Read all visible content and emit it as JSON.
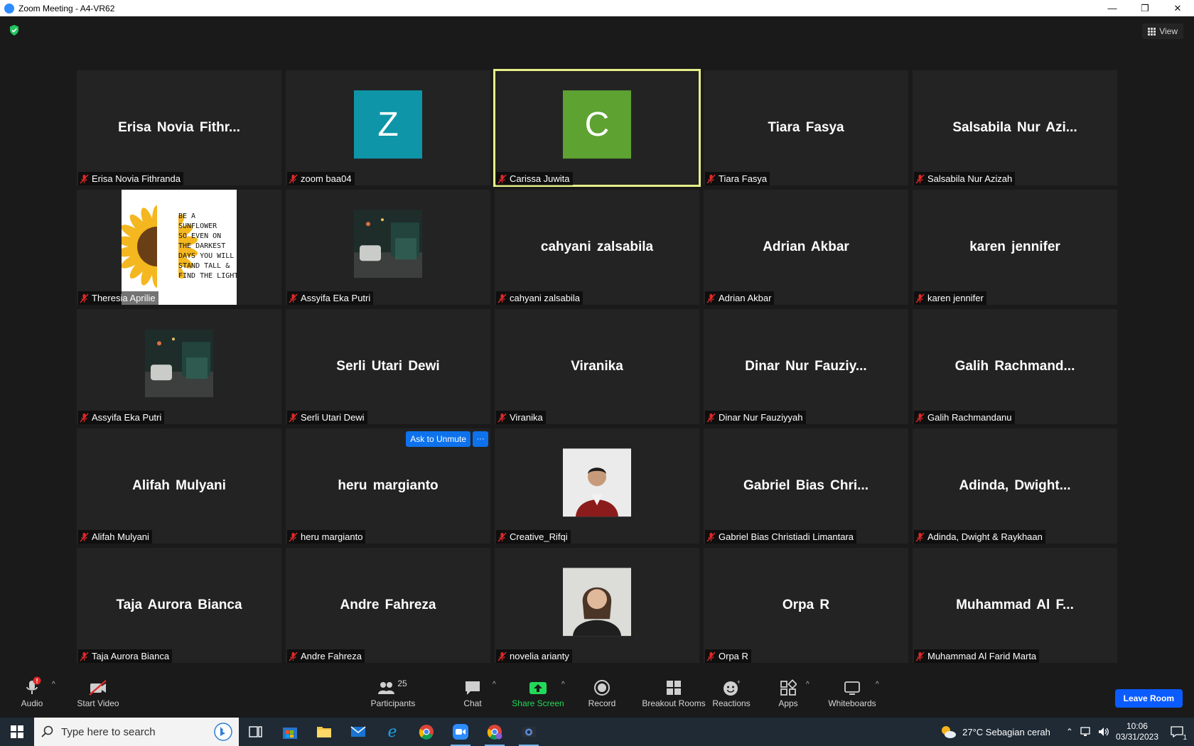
{
  "window": {
    "title": "Zoom Meeting - A4-VR62",
    "minimize": "—",
    "restore": "❐",
    "close": "✕"
  },
  "meeting": {
    "view_label": "View"
  },
  "participants": [
    {
      "display": "Erisa  Novia  Fithr...",
      "name": "Erisa Novia Fithranda",
      "kind": "name"
    },
    {
      "display": "Z",
      "name": "zoom baa04",
      "kind": "avatar",
      "color": "#0e95a8"
    },
    {
      "display": "C",
      "name": "Carissa Juwita",
      "kind": "avatar",
      "color": "#5ea232",
      "active": true
    },
    {
      "display": "Tiara Fasya",
      "name": "Tiara Fasya",
      "kind": "name"
    },
    {
      "display": "Salsabila  Nur  Azi...",
      "name": "Salsabila Nur Azizah",
      "kind": "name"
    },
    {
      "display": "",
      "name": "Theresia Aprilie",
      "kind": "sticker",
      "sticker_text": [
        "BE A",
        "SUNFLOWER",
        "SO EVEN ON",
        "THE DARKEST",
        "DAYS YOU WILL",
        "STAND TALL &",
        "FIND THE LIGHT"
      ]
    },
    {
      "display": "",
      "name": "Assyifa Eka Putri",
      "kind": "photo-street"
    },
    {
      "display": "cahyani zalsabila",
      "name": "cahyani zalsabila",
      "kind": "name"
    },
    {
      "display": "Adrian Akbar",
      "name": "Adrian Akbar",
      "kind": "name"
    },
    {
      "display": "karen jennifer",
      "name": "karen jennifer",
      "kind": "name"
    },
    {
      "display": "",
      "name": "Assyifa Eka Putri",
      "kind": "photo-street"
    },
    {
      "display": "Serli Utari Dewi",
      "name": "Serli Utari Dewi",
      "kind": "name"
    },
    {
      "display": "Viranika",
      "name": "Viranika",
      "kind": "name"
    },
    {
      "display": "Dinar  Nur  Fauziy...",
      "name": "Dinar Nur Fauziyyah",
      "kind": "name"
    },
    {
      "display": "Galih  Rachmand...",
      "name": "Galih Rachmandanu",
      "kind": "name"
    },
    {
      "display": "Alifah Mulyani",
      "name": "Alifah Mulyani",
      "kind": "name"
    },
    {
      "display": "heru margianto",
      "name": "heru margianto",
      "kind": "name",
      "hover": true
    },
    {
      "display": "",
      "name": "Creative_Rifqi",
      "kind": "photo-person"
    },
    {
      "display": "Gabriel  Bias  Chri...",
      "name": "Gabriel Bias Christiadi Limantara",
      "kind": "name"
    },
    {
      "display": "Adinda,  Dwight...",
      "name": "Adinda, Dwight & Raykhaan",
      "kind": "name"
    },
    {
      "display": "Taja Aurora Bianca",
      "name": "Taja Aurora Bianca",
      "kind": "name"
    },
    {
      "display": "Andre Fahreza",
      "name": "Andre Fahreza",
      "kind": "name"
    },
    {
      "display": "",
      "name": "novelia arianty",
      "kind": "photo-woman"
    },
    {
      "display": "Orpa R",
      "name": "Orpa R",
      "kind": "name"
    },
    {
      "display": "Muhammad  Al  F...",
      "name": "Muhammad Al Farid Marta",
      "kind": "name"
    }
  ],
  "hover_actions": {
    "ask_unmute": "Ask to Unmute",
    "more": "···"
  },
  "toolbar": {
    "audio": "Audio",
    "audio_badge": "!",
    "start_video": "Start Video",
    "participants": "Participants",
    "participant_count": "25",
    "chat": "Chat",
    "share_screen": "Share Screen",
    "record": "Record",
    "breakout_rooms": "Breakout Rooms",
    "reactions": "Reactions",
    "apps": "Apps",
    "whiteboards": "Whiteboards",
    "leave": "Leave Room"
  },
  "taskbar": {
    "search_placeholder": "Type here to search",
    "weather": "27°C  Sebagian cerah",
    "time": "10:06",
    "date": "03/31/2023",
    "notification_count": "1"
  },
  "colors": {
    "accent": "#0e72ed",
    "active_speaker": "#e7ef8a",
    "share_green": "#23d959",
    "muted_red": "#e02828"
  }
}
